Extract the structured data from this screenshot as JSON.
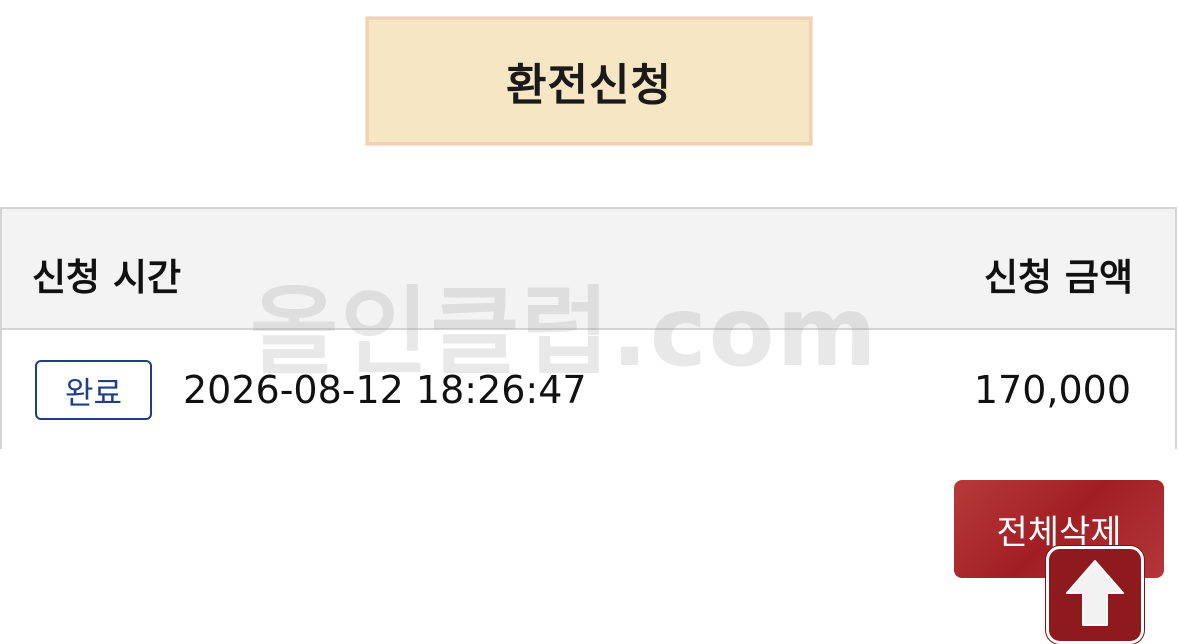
{
  "header": {
    "title": "환전신청"
  },
  "table": {
    "columns": {
      "time": "신청 시간",
      "amount": "신청 금액"
    },
    "rows": [
      {
        "status": "완료",
        "datetime": "2026-08-12 18:26:47",
        "amount": "170,000"
      }
    ]
  },
  "watermark": "올인클럽.com",
  "actions": {
    "delete_all_label": "전체삭제"
  },
  "icons": {
    "scroll_top": "arrow-up-icon"
  },
  "colors": {
    "title_bg": "#f6e6c4",
    "title_border": "#f0d2b8",
    "badge_accent": "#1e3f86",
    "delete_button": "#a11f24",
    "scroll_top_button": "#8f1a1e"
  }
}
